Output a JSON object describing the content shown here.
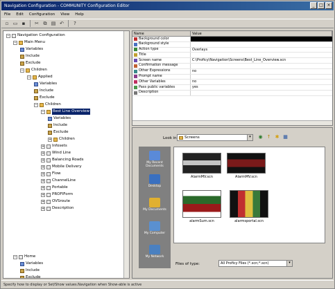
{
  "window": {
    "title": "Navigation Configuration - COMMUNITY Configuration Editor",
    "buttons": [
      "_",
      "□",
      "×"
    ]
  },
  "menu": [
    "File",
    "Edit",
    "Configuration",
    "View",
    "Help"
  ],
  "toolbar_icons": [
    "new-icon",
    "open-icon",
    "save-icon",
    "cut-icon",
    "copy-icon",
    "paste-icon",
    "undo-icon",
    "help-icon"
  ],
  "tree": [
    {
      "label": "Navigation Configuration",
      "icon": "set"
    },
    {
      "label": "Main Menu",
      "icon": "folder"
    },
    {
      "label": "Variables",
      "icon": "var"
    },
    {
      "label": "Include",
      "icon": "item"
    },
    {
      "label": "Exclude",
      "icon": "item"
    },
    {
      "label": "Children",
      "icon": "folder"
    },
    {
      "label": "Applied",
      "icon": "folder"
    },
    {
      "label": "Variables",
      "icon": "var"
    },
    {
      "label": "Include",
      "icon": "item"
    },
    {
      "label": "Exclude",
      "icon": "item"
    },
    {
      "label": "Children",
      "icon": "folder"
    },
    {
      "label": "Best Line Overview",
      "icon": "folder"
    },
    {
      "label": "Variables",
      "icon": "var"
    },
    {
      "label": "Include",
      "icon": "item"
    },
    {
      "label": "Exclude",
      "icon": "item"
    },
    {
      "label": "Children",
      "icon": "folder"
    },
    {
      "label": "Infosets",
      "icon": "set"
    },
    {
      "label": "Wind Line",
      "icon": "set"
    },
    {
      "label": "Balancing Roads",
      "icon": "set"
    },
    {
      "label": "Mobile Delivery",
      "icon": "set"
    },
    {
      "label": "Flow",
      "icon": "set"
    },
    {
      "label": "ChannelLine",
      "icon": "set"
    },
    {
      "label": "Portable",
      "icon": "set"
    },
    {
      "label": "PROFIForm",
      "icon": "set"
    },
    {
      "label": "OVSroute",
      "icon": "set"
    },
    {
      "label": "Description",
      "icon": "set"
    },
    {
      "label": "Home",
      "icon": "set"
    },
    {
      "label": "Variables",
      "icon": "var"
    },
    {
      "label": "Include",
      "icon": "item"
    },
    {
      "label": "Exclude",
      "icon": "item"
    }
  ],
  "properties": {
    "headers": [
      "Name",
      "Value"
    ],
    "rows": [
      {
        "name": "Background color",
        "value": "",
        "dark": true
      },
      {
        "name": "Background style",
        "value": ""
      },
      {
        "name": "Action type",
        "value": "Overlays"
      },
      {
        "name": "Title",
        "value": ""
      },
      {
        "name": "Screen name",
        "value": "C:\\Proficy\\Navigation\\Screens\\Best_Line_Overview.scn"
      },
      {
        "name": "Confirmation message",
        "value": ""
      },
      {
        "name": "Other Expressions",
        "value": "no"
      },
      {
        "name": "Prompt name",
        "value": ""
      },
      {
        "name": "Other Variables",
        "value": "no"
      },
      {
        "name": "Pass public variables",
        "value": "yes"
      },
      {
        "name": "Description",
        "value": ""
      }
    ]
  },
  "dialog": {
    "look_in_label": "Look in:",
    "look_in_value": "Screens",
    "files_of_type_label": "Files of type:",
    "files_of_type_value": "All Proficy Files (*.scn;*.scn)",
    "places": [
      "My Recent Documents",
      "Desktop",
      "My Documents",
      "My Computer",
      "My Network"
    ],
    "files": [
      "AlarmMV.scn",
      "AlarmMV.scn",
      "alarmSum.scn",
      "alarmsportal.scn"
    ]
  },
  "status": "Specify how to display or Set/Show values.Navigation when Show-able is active"
}
